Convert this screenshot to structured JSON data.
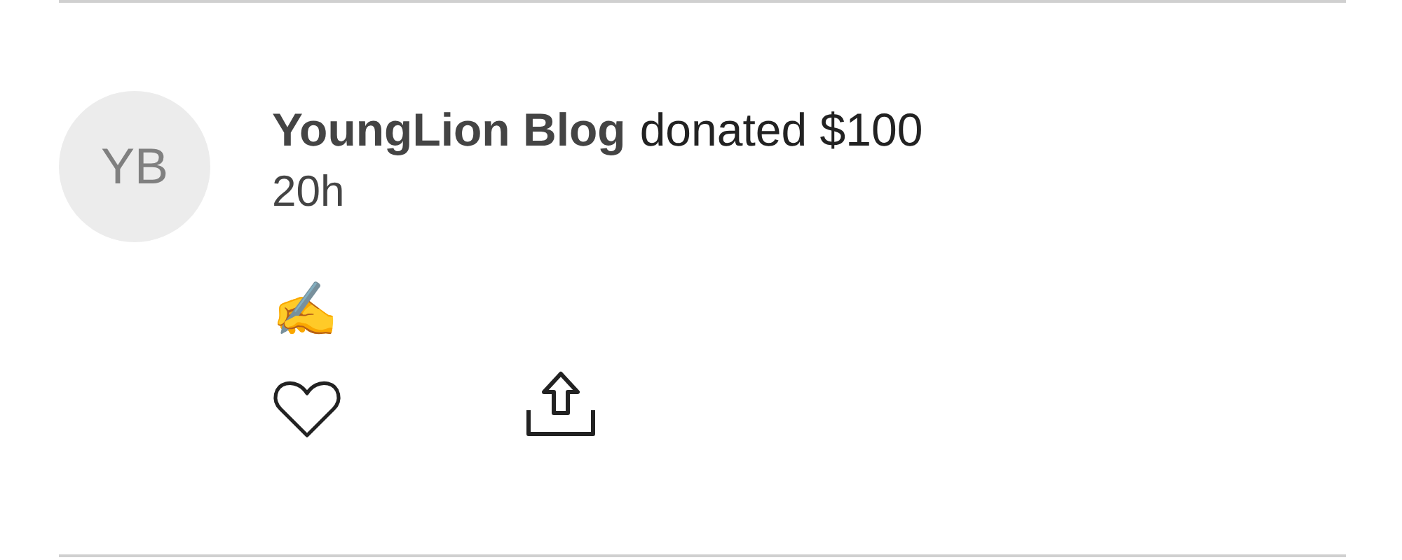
{
  "post": {
    "avatar_initials": "YB",
    "author": "YoungLion Blog",
    "action": "donated $100",
    "time": "20h",
    "message": "✍️",
    "liked": false
  }
}
